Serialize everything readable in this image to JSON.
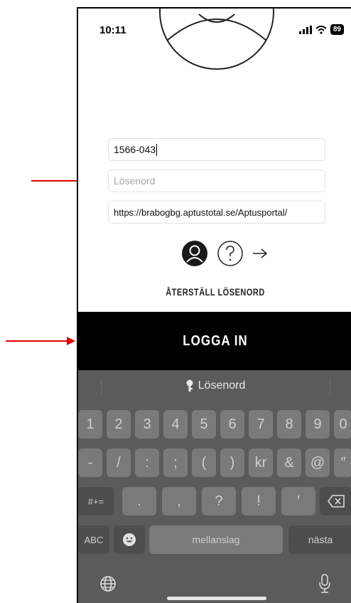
{
  "status_bar": {
    "time": "10:11",
    "battery": "89"
  },
  "form": {
    "username_value": "1566-043",
    "password_placeholder": "Lösenord",
    "server_url": "https://brabogbg.aptustotal.se/Aptusportal/"
  },
  "actions": {
    "reset_password": "ÅTERSTÄLL LÖSENORD",
    "login_button": "LOGGA IN"
  },
  "keyboard": {
    "suggestion": "Lösenord",
    "row1": [
      "1",
      "2",
      "3",
      "4",
      "5",
      "6",
      "7",
      "8",
      "9",
      "0"
    ],
    "row2": [
      "-",
      "/",
      ":",
      ";",
      "(",
      ")",
      "kr",
      "&",
      "@",
      "″"
    ],
    "row3": [
      ".",
      ",",
      "?",
      "!",
      "′"
    ],
    "shift_label": "#+=",
    "abc_label": "ABC",
    "space_label": "mellanslag",
    "next_label": "nästa"
  },
  "colors": {
    "annotation_arrow": "#e00000",
    "login_bar": "#000000",
    "keyboard_bg": "#5b5b5b"
  }
}
